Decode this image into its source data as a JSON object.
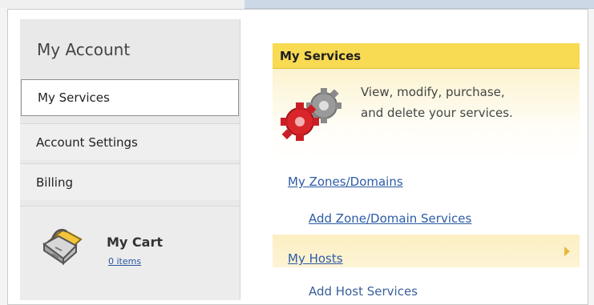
{
  "sidebar": {
    "title": "My Account",
    "items": [
      {
        "label": "My Services"
      },
      {
        "label": "Account Settings"
      },
      {
        "label": "Billing"
      }
    ],
    "cart": {
      "title": "My Cart",
      "count_label": "0 items"
    }
  },
  "main": {
    "section": {
      "title": "My Services",
      "description_line1": "View, modify, purchase,",
      "description_line2": "and delete your services."
    },
    "links": {
      "zones": "My Zones/Domains",
      "add_zone": "Add Zone/Domain Services",
      "hosts": "My Hosts",
      "add_host": "Add Host Services"
    }
  },
  "colors": {
    "accent": "#f8da53",
    "link": "#2c5ba6",
    "gear_red": "#d9262b",
    "gear_gray": "#9a9a9a"
  },
  "icons": [
    "gears-icon",
    "cart-icon",
    "chevron-right-icon"
  ]
}
